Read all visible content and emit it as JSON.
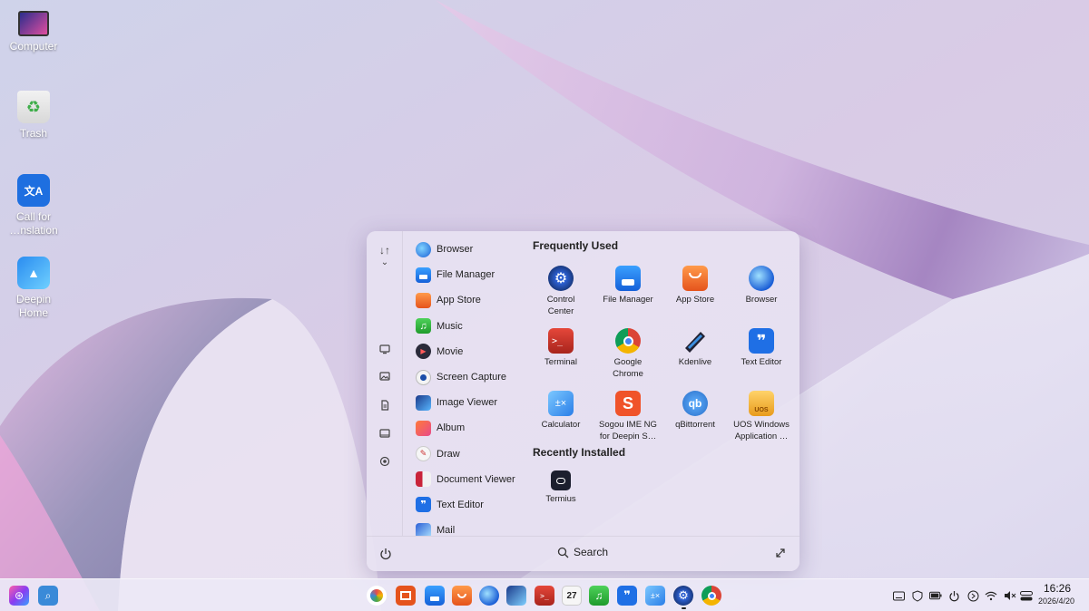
{
  "desktop": {
    "icons": [
      {
        "label": "Computer",
        "icon": "computer-icon"
      },
      {
        "label": "Trash",
        "icon": "trash-icon"
      },
      {
        "label": "Call for\n…nslation",
        "icon": "translation-icon"
      },
      {
        "label": "Deepin\nHome",
        "icon": "deepin-home-icon"
      }
    ]
  },
  "launcher": {
    "app_list": [
      {
        "label": "Browser",
        "icon": "browser-icon"
      },
      {
        "label": "File Manager",
        "icon": "file-manager-icon"
      },
      {
        "label": "App Store",
        "icon": "app-store-icon"
      },
      {
        "label": "Music",
        "icon": "music-icon"
      },
      {
        "label": "Movie",
        "icon": "movie-icon"
      },
      {
        "label": "Screen Capture",
        "icon": "screen-capture-icon"
      },
      {
        "label": "Image Viewer",
        "icon": "image-viewer-icon"
      },
      {
        "label": "Album",
        "icon": "album-icon"
      },
      {
        "label": "Draw",
        "icon": "draw-icon"
      },
      {
        "label": "Document Viewer",
        "icon": "document-viewer-icon"
      },
      {
        "label": "Text Editor",
        "icon": "text-editor-icon"
      },
      {
        "label": "Mail",
        "icon": "mail-icon"
      }
    ],
    "frequently_used_title": "Frequently Used",
    "frequently_used": [
      {
        "label": "Control\nCenter",
        "icon": "control-center-icon"
      },
      {
        "label": "File Manager",
        "icon": "file-manager-icon"
      },
      {
        "label": "App Store",
        "icon": "app-store-icon"
      },
      {
        "label": "Browser",
        "icon": "browser-icon"
      },
      {
        "label": "Terminal",
        "icon": "terminal-icon"
      },
      {
        "label": "Google\nChrome",
        "icon": "chrome-icon"
      },
      {
        "label": "Kdenlive",
        "icon": "kdenlive-icon"
      },
      {
        "label": "Text Editor",
        "icon": "text-editor-icon"
      },
      {
        "label": "Calculator",
        "icon": "calculator-icon"
      },
      {
        "label": "Sogou IME NG\nfor Deepin S…",
        "icon": "sogou-icon"
      },
      {
        "label": "qBittorrent",
        "icon": "qbittorrent-icon"
      },
      {
        "label": "UOS Windows\nApplication …",
        "icon": "uos-windows-icon"
      }
    ],
    "recently_installed_title": "Recently Installed",
    "recently_installed": [
      {
        "label": "Termius",
        "icon": "termius-icon"
      }
    ],
    "search_label": "Search"
  },
  "taskbar": {
    "clock_time": "16:26",
    "clock_date": "2026/4/20",
    "calendar_day": "27"
  },
  "colors": {
    "accent": "#1f6fe5",
    "launcher_bg": "#e8e2f2"
  }
}
